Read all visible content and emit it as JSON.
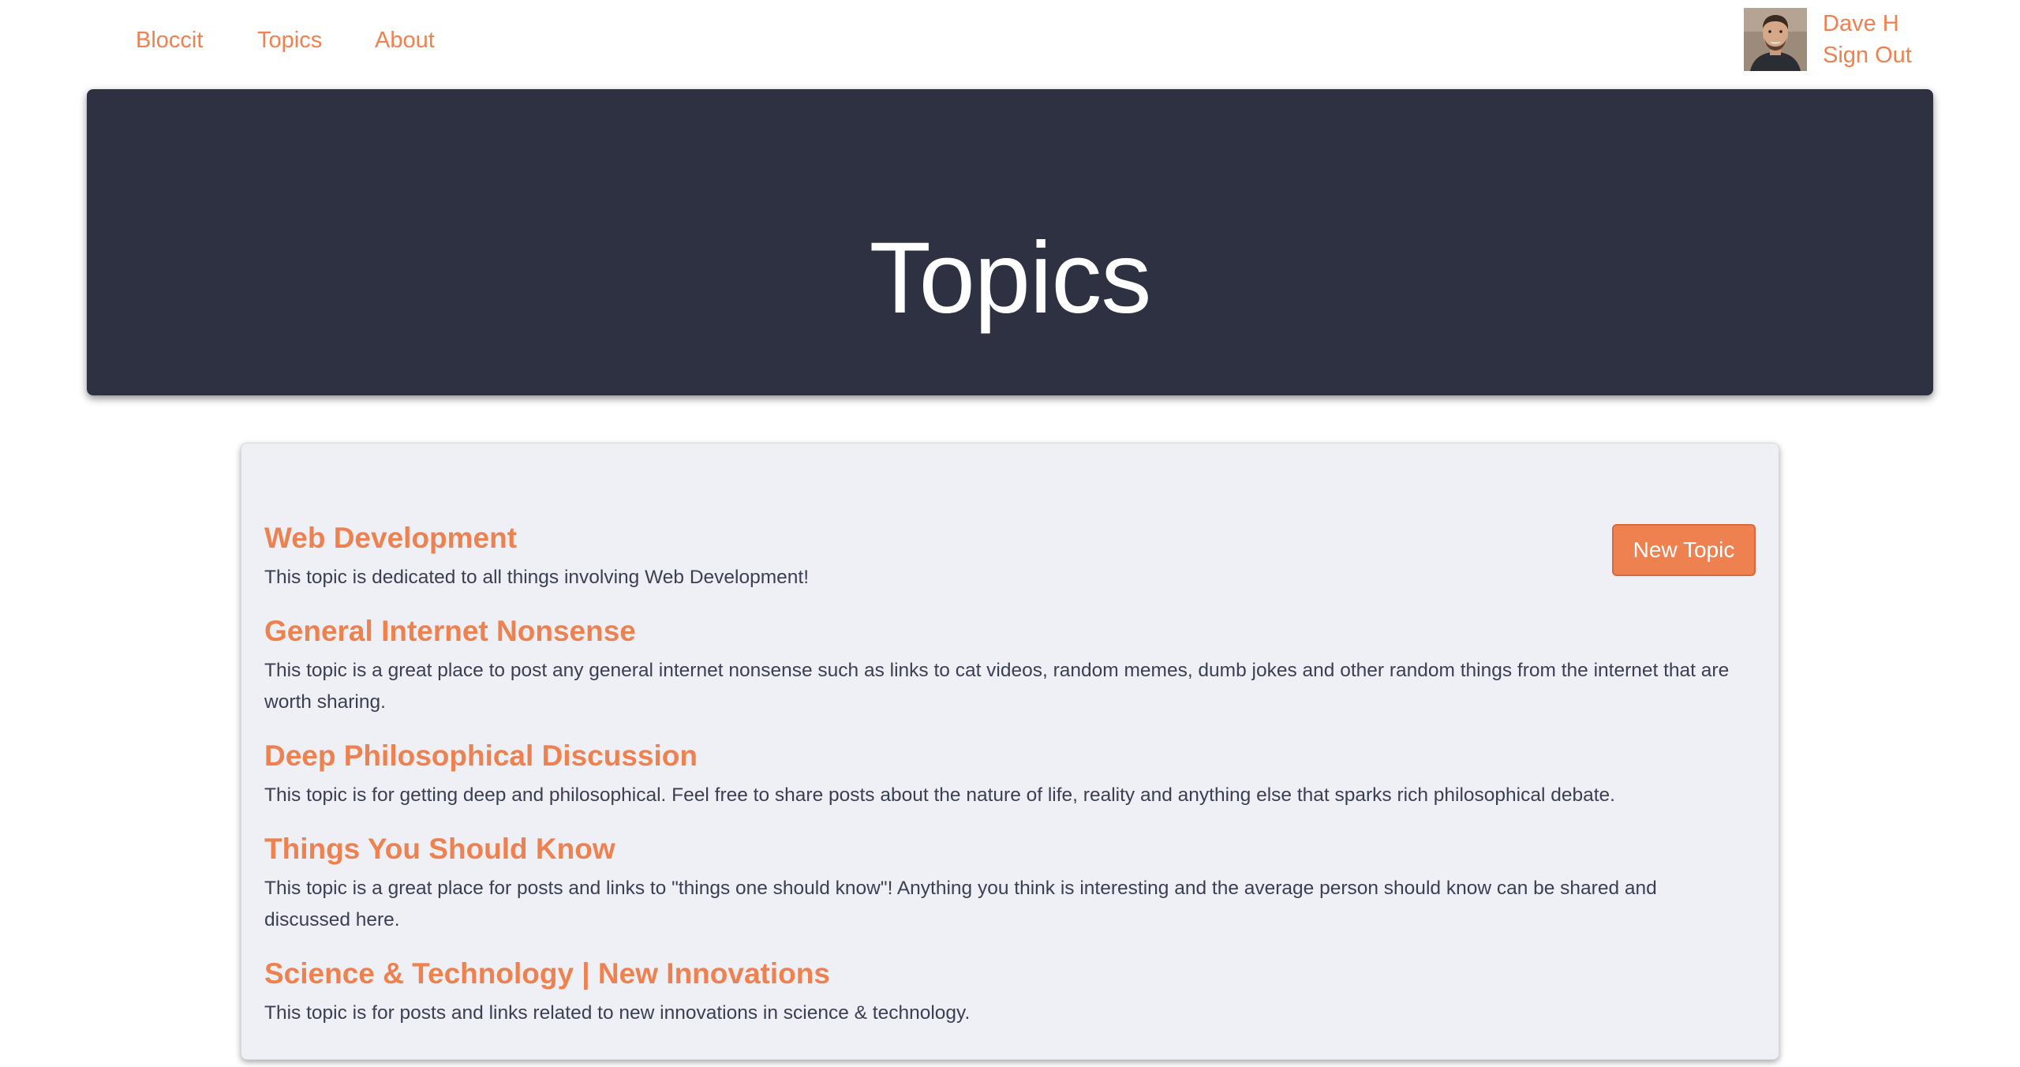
{
  "nav": {
    "links": [
      {
        "label": "Bloccit"
      },
      {
        "label": "Topics"
      },
      {
        "label": "About"
      }
    ]
  },
  "user": {
    "name": "Dave H",
    "sign_out_label": "Sign Out"
  },
  "hero": {
    "title": "Topics"
  },
  "toolbar": {
    "new_topic_label": "New Topic"
  },
  "topics": [
    {
      "title": "Web Development",
      "description": "This topic is dedicated to all things involving Web Development!"
    },
    {
      "title": "General Internet Nonsense",
      "description": "This topic is a great place to post any general internet nonsense such as links to cat videos, random memes, dumb jokes and other random things from the internet that are worth sharing."
    },
    {
      "title": "Deep Philosophical Discussion",
      "description": "This topic is for getting deep and philosophical. Feel free to share posts about the nature of life, reality and anything else that sparks rich philosophical debate."
    },
    {
      "title": "Things You Should Know",
      "description": "This topic is a great place for posts and links to \"things one should know\"! Anything you think is interesting and the average person should know can be shared and discussed here."
    },
    {
      "title": "Science & Technology | New Innovations",
      "description": "This topic is for posts and links related to new innovations in science & technology."
    }
  ],
  "colors": {
    "accent": "#ee8150",
    "hero_background": "#2e3142",
    "panel_background": "#eef0f5",
    "body_text": "#3a3f52"
  }
}
